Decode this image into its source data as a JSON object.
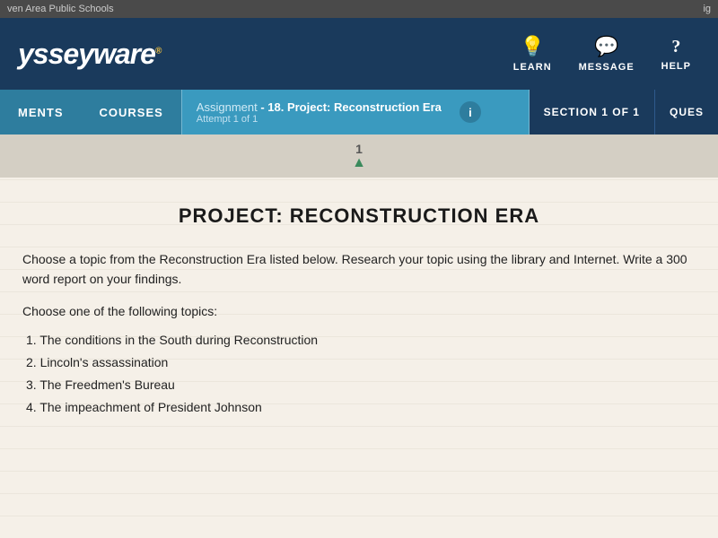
{
  "browser": {
    "school_label": "ven Area Public Schools",
    "top_right": "ig"
  },
  "header": {
    "logo": "ysseyware",
    "logo_prefix": "",
    "icons": [
      {
        "id": "learn",
        "symbol": "💡",
        "label": "LEARN"
      },
      {
        "id": "message",
        "symbol": "💬",
        "label": "MESSAGE"
      },
      {
        "id": "help",
        "symbol": "?",
        "label": "HELP"
      }
    ]
  },
  "nav": {
    "items": [
      {
        "id": "ments",
        "label": "MENTS"
      },
      {
        "id": "courses",
        "label": "COURSES"
      }
    ],
    "assignment": {
      "prefix": "Assignment",
      "title": " - 18. Project: Reconstruction Era",
      "attempt": "Attempt 1 of 1"
    },
    "section": "SECTION 1 OF 1",
    "ques": "QUES"
  },
  "progress": {
    "number": "1"
  },
  "content": {
    "title": "PROJECT: RECONSTRUCTION ERA",
    "intro": "Choose a topic from the Reconstruction Era listed below. Research your topic using the library and Internet. Write a 300 word report on your findings.",
    "topics_header": "Choose one of the following topics:",
    "topics": [
      "1. The conditions in the South during Reconstruction",
      "2. Lincoln's assassination",
      "3. The Freedmen's Bureau",
      "4. The impeachment of President Johnson"
    ]
  }
}
